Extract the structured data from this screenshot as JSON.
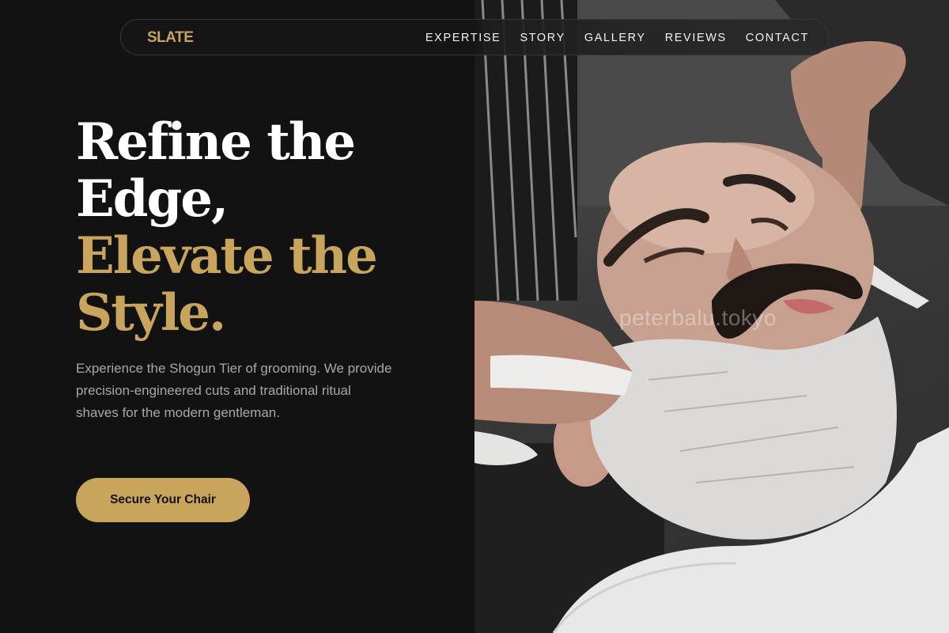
{
  "brand": {
    "logo": "SLATE",
    "accent_color": "#c9a45c"
  },
  "nav": {
    "items": [
      {
        "label": "EXPERTISE"
      },
      {
        "label": "STORY"
      },
      {
        "label": "GALLERY"
      },
      {
        "label": "REVIEWS"
      },
      {
        "label": "CONTACT"
      }
    ]
  },
  "hero": {
    "title_lines": [
      "Refine the",
      "Edge,"
    ],
    "highlight_lines": [
      "Elevate the",
      "Style."
    ],
    "description": "Experience the Shogun Tier of grooming. We provide precision-engineered cuts and traditional ritual shaves for the modern gentleman.",
    "cta_label": "Secure Your Chair"
  },
  "photo": {
    "watermark": "peterbalu.tokyo"
  }
}
